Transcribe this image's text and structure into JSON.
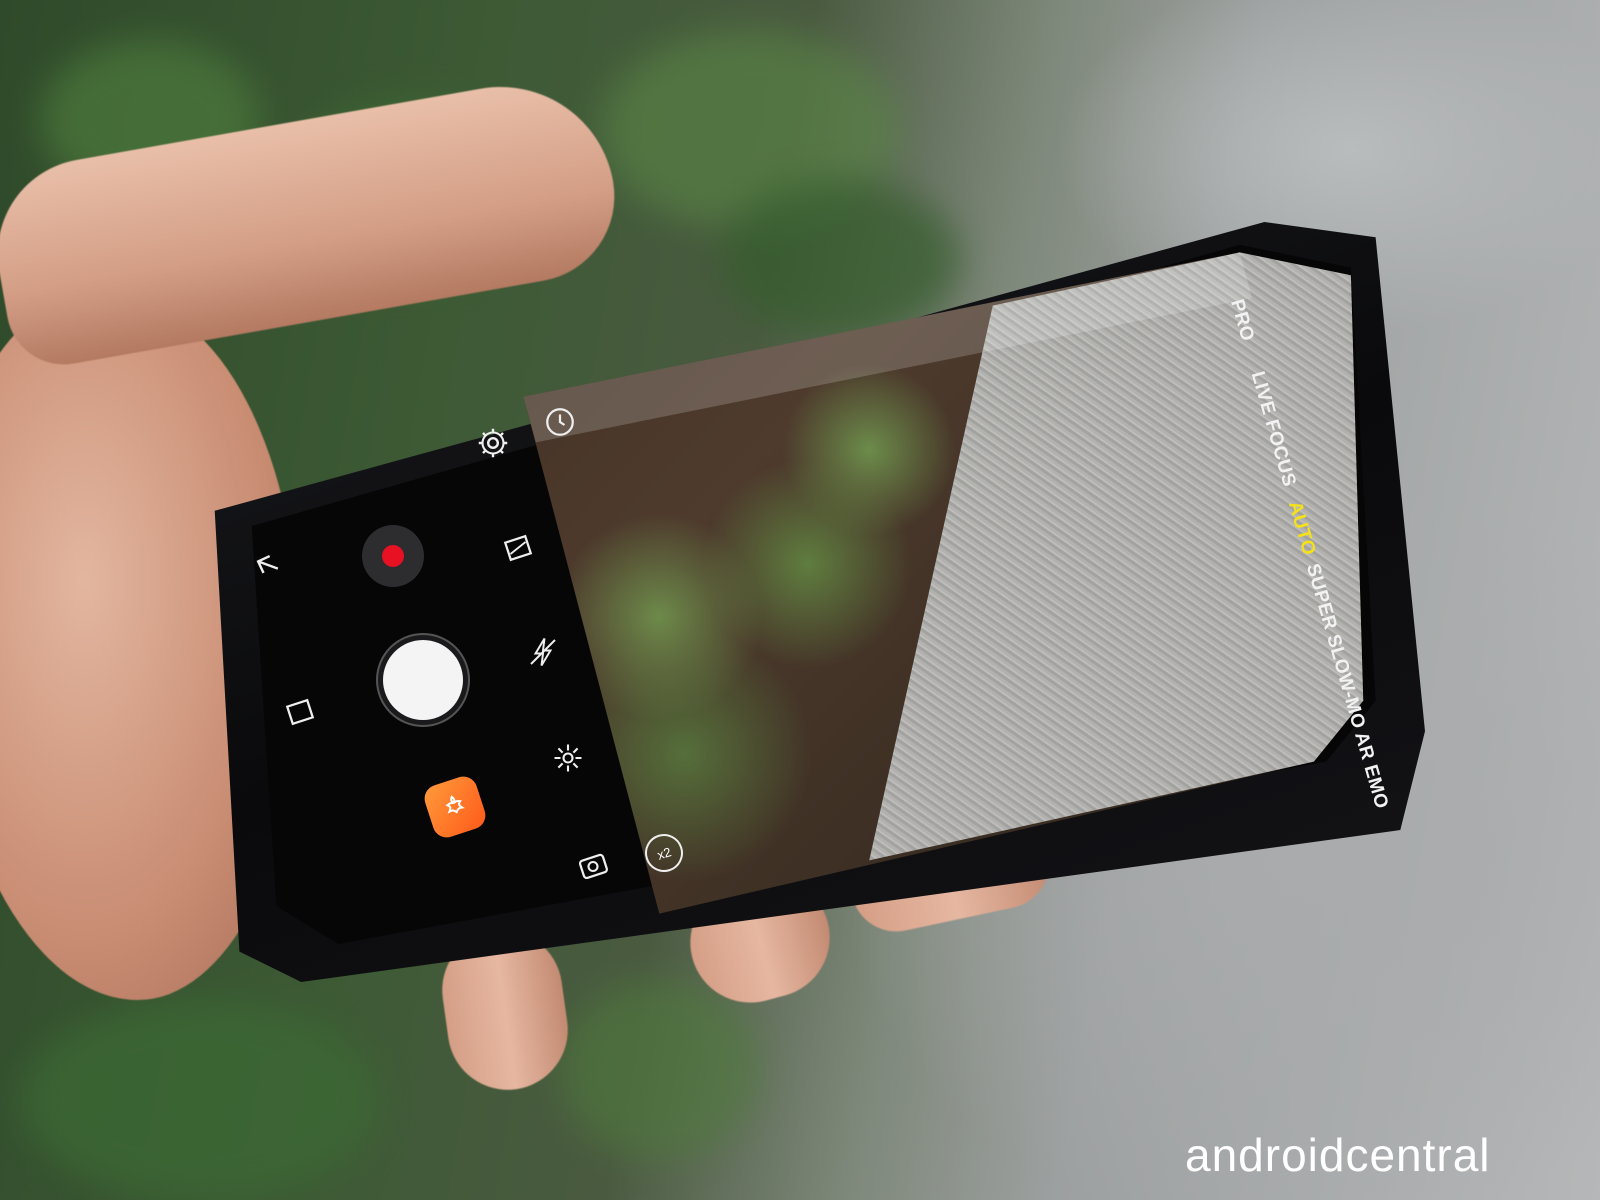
{
  "scene": {
    "description_free": true
  },
  "camera_ui": {
    "modes": [
      {
        "label": "PRO",
        "active": false
      },
      {
        "label": "LIVE FOCUS",
        "active": false
      },
      {
        "label": "AUTO",
        "active": true
      },
      {
        "label": "SUPER SLOW-MO",
        "active": false
      },
      {
        "label": "AR EMO",
        "active": false
      }
    ],
    "zoom_label": "x2",
    "icons": {
      "settings": "gear-icon",
      "timer": "timer-icon",
      "aspect_ratio": "aspect-ratio-icon",
      "flash": "flash-off-icon",
      "effects": "sparkle-icon",
      "switch_camera": "switch-camera-icon",
      "back": "back-arrow-icon",
      "gallery": "gallery-thumbnail-icon",
      "record": "record-icon",
      "shutter": "shutter-button",
      "bixby": "bixby-vision-icon"
    },
    "colors": {
      "record": "#e81023",
      "active_mode": "#f4e11a",
      "bixby": "#ff6a22"
    }
  },
  "watermark": {
    "text": "androidcentral"
  }
}
